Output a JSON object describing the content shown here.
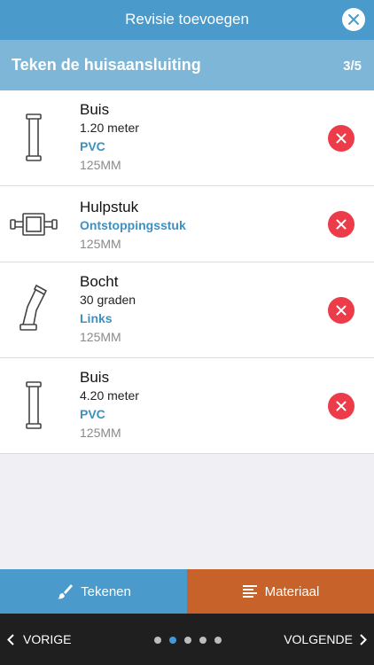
{
  "header": {
    "title": "Revisie toevoegen",
    "close_icon": "close-icon"
  },
  "step": {
    "title": "Teken de huisaansluiting",
    "count": "3/5"
  },
  "items": [
    {
      "icon": "pipe-icon",
      "name": "Buis",
      "line1": "1.20 meter",
      "line2": "PVC",
      "line3": "125MM"
    },
    {
      "icon": "coupling-icon",
      "name": "Hulpstuk",
      "line1": "Ontstoppingsstuk",
      "line2": "125MM"
    },
    {
      "icon": "bend-icon",
      "name": "Bocht",
      "line1": "30 graden",
      "line2": "Links",
      "line3": "125MM"
    },
    {
      "icon": "pipe-icon",
      "name": "Buis",
      "line1": "4.20 meter",
      "line2": "PVC",
      "line3": "125MM"
    }
  ],
  "tabs": {
    "draw_label": "Tekenen",
    "material_label": "Materiaal"
  },
  "footer": {
    "prev_label": "VORIGE",
    "next_label": "VOLGENDE",
    "pages": 5,
    "active_page": 2
  },
  "colors": {
    "header": "#4a9bcb",
    "step": "#7db6d6",
    "delete": "#ec3c4a",
    "draw_tab": "#4a9bcb",
    "material_tab": "#c7622a",
    "footer": "#1f1f1f",
    "link": "#3f8fc0"
  }
}
